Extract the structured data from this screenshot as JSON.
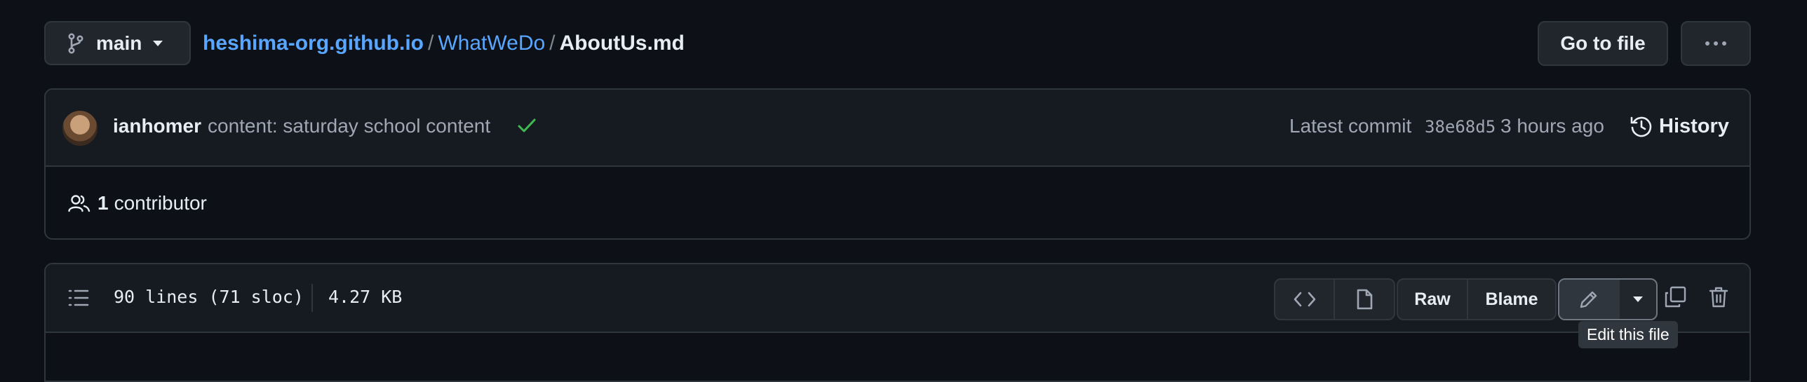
{
  "branch": {
    "name": "main"
  },
  "breadcrumb": {
    "repo": "heshima-org.github.io",
    "directory": "WhatWeDo",
    "separator": "/",
    "file": "AboutUs.md"
  },
  "actions": {
    "go_to_file": "Go to file"
  },
  "commit": {
    "author": "ianhomer",
    "message": "content: saturday school content",
    "latest_label": "Latest commit",
    "sha": "38e68d5",
    "time_ago": "3 hours ago",
    "history_label": "History"
  },
  "contributors": {
    "count": "1",
    "label": "contributor"
  },
  "file_info": {
    "lines": "90 lines (71 sloc)",
    "size": "4.27 KB"
  },
  "file_actions": {
    "raw": "Raw",
    "blame": "Blame"
  },
  "tooltip": {
    "text": "Edit this file"
  },
  "icons": [
    "git-branch-icon",
    "triangle-down-icon",
    "kebab-horizontal-icon",
    "check-icon",
    "history-icon",
    "people-icon",
    "list-unordered-icon",
    "code-icon",
    "file-icon",
    "pencil-icon",
    "copy-icon",
    "trash-icon"
  ],
  "colors": {
    "background": "#0d1117",
    "link": "#58a6ff",
    "success": "#3fb950",
    "border": "#30363d",
    "muted": "#9ea7b3"
  }
}
